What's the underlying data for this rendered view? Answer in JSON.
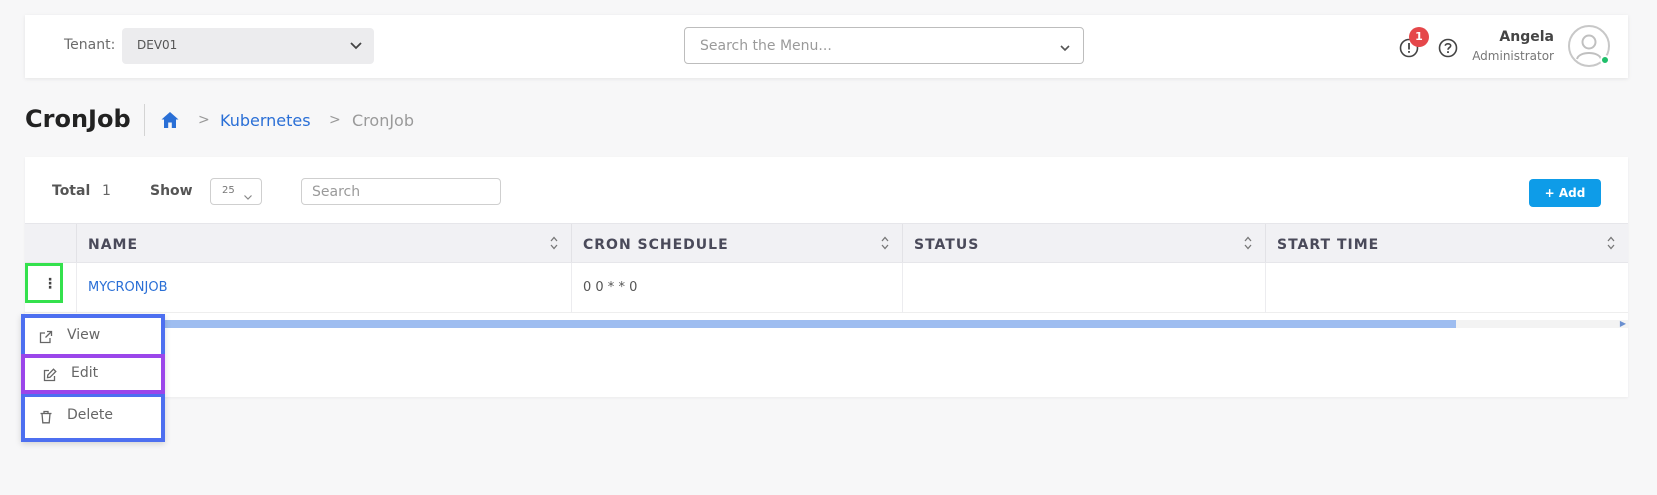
{
  "header": {
    "tenant_label": "Tenant:",
    "tenant_value": "DEV01",
    "menu_search_placeholder": "Search the Menu...",
    "alert_count": "1",
    "user_name": "Angela",
    "user_role": "Administrator",
    "icons": [
      "chevron-down-icon",
      "alert-icon",
      "help-icon",
      "avatar-icon"
    ]
  },
  "page": {
    "title": "CronJob",
    "breadcrumb": {
      "home_icon": "home-icon",
      "separator": ">",
      "items": [
        "Kubernetes",
        "CronJob"
      ]
    }
  },
  "toolbar": {
    "total_label": "Total",
    "total_value": "1",
    "show_label": "Show",
    "show_value": "25",
    "search_placeholder": "Search",
    "add_label": "+ Add"
  },
  "table": {
    "columns": [
      "NAME",
      "CRON SCHEDULE",
      "STATUS",
      "START TIME"
    ],
    "rows": [
      {
        "name": "MYCRONJOB",
        "cron_schedule": "0 0 * * 0",
        "status": "",
        "start_time": ""
      }
    ]
  },
  "context_menu": {
    "items": [
      {
        "label": "View",
        "icon": "external-link-icon"
      },
      {
        "label": "Edit",
        "icon": "edit-icon"
      },
      {
        "label": "Delete",
        "icon": "trash-icon"
      }
    ]
  },
  "colors": {
    "accent": "#0e9ce8",
    "link": "#2a6fd6",
    "badge": "#e5474a",
    "online": "#1fbf6a",
    "highlight_kebab": "#34e14d",
    "highlight_menu": "#4d6ff0",
    "highlight_edit": "#9b46ea"
  }
}
